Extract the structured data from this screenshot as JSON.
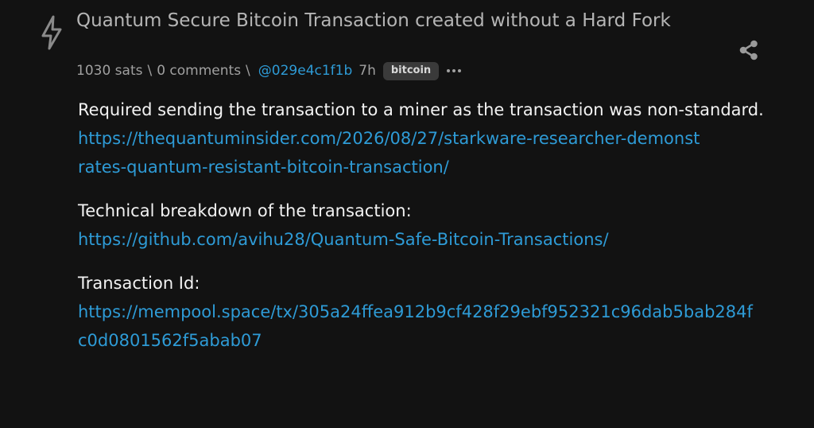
{
  "post": {
    "title": "Quantum Secure Bitcoin Transaction created without a Hard Fork",
    "meta": {
      "sats": "1030 sats",
      "sep1": "\\",
      "comments": "0 comments",
      "sep2": "\\",
      "user": "@029e4c1f1b",
      "time": "7h",
      "tag": "bitcoin"
    },
    "icons": {
      "logo": "lightning-bolt-icon",
      "more": "more-options-icon",
      "share": "share-icon"
    },
    "colors": {
      "background": "#121212",
      "link": "#2e9bd6",
      "title": "#b5b5b5"
    },
    "body": {
      "p1_text": "Required sending the transaction to a miner as the transaction was non-standard.",
      "p1_link": "https://thequantuminsider.com/2026/08/27/starkware-researcher-demonstrates-quantum-resistant-bitcoin-transaction/",
      "p2_text": "Technical breakdown of the transaction:",
      "p2_link": "https://github.com/avihu28/Quantum-Safe-Bitcoin-Transactions/",
      "p3_text": "Transaction Id:",
      "p3_link": "https://mempool.space/tx/305a24ffea912b9cf428f29ebf952321c96dab5bab284fc0d0801562f5abab07"
    }
  }
}
